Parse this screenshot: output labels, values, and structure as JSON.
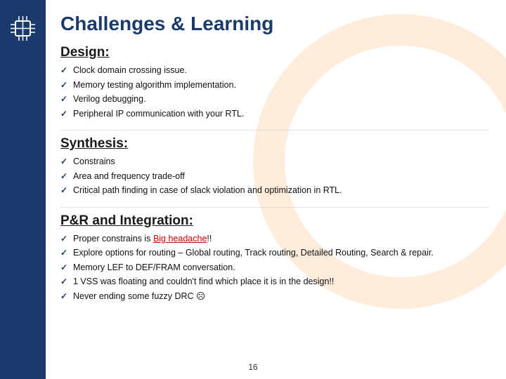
{
  "slide": {
    "title": "Challenges & Learning",
    "slide_number": "16",
    "sections": [
      {
        "id": "design",
        "heading": "Design:",
        "bullets": [
          "Clock domain crossing issue.",
          "Memory testing algorithm implementation.",
          "Verilog debugging.",
          "Peripheral IP communication with your RTL."
        ],
        "special": []
      },
      {
        "id": "synthesis",
        "heading": "Synthesis:",
        "bullets": [
          "Constrains",
          "Area and frequency trade-off",
          "Critical path finding in case of slack violation and optimization in RTL."
        ],
        "special": []
      },
      {
        "id": "par",
        "heading": "P&R and Integration:",
        "bullets": [
          "Proper constrains is Big headache!!",
          "Explore options for routing – Global routing, Track routing, Detailed Routing, Search & repair.",
          "Memory LEF to DEF/FRAM conversation.",
          "1 VSS was floating and couldn't find which place it is in the design!!",
          "Never ending some fuzzy DRC ☹"
        ],
        "special": [
          {
            "bullet_index": 0,
            "text": "Big headache",
            "style": "red-underline"
          }
        ]
      }
    ]
  }
}
